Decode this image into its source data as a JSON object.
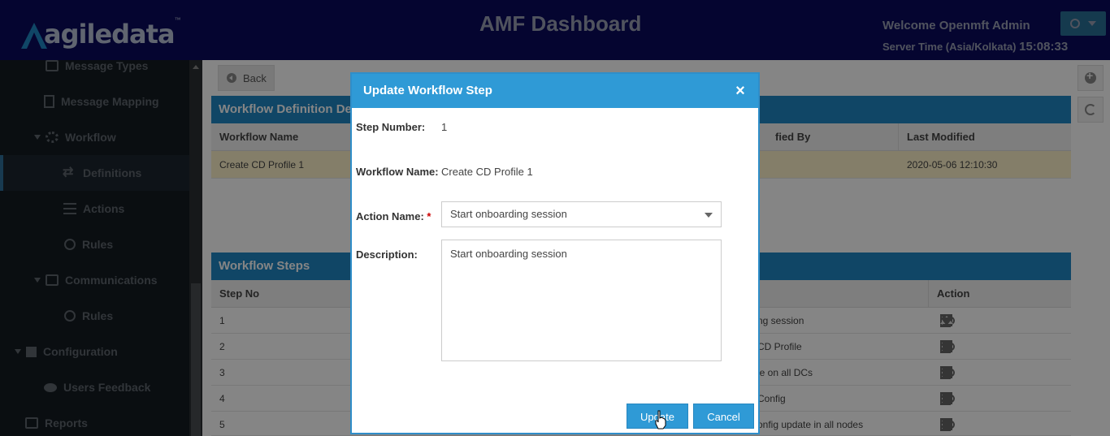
{
  "header": {
    "logo_text": "agiledata",
    "logo_tm": "™",
    "title": "AMF Dashboard",
    "welcome": "Welcome Openmft Admin",
    "server_time_label": "Server Time (Asia/Kolkata)",
    "server_time_value": "15:08:33"
  },
  "sidebar": {
    "items": [
      {
        "label": "Message Types",
        "icon": "box-icon"
      },
      {
        "label": "Message Mapping",
        "icon": "file-code-icon"
      },
      {
        "label": "Workflow",
        "icon": "gear-icon"
      },
      {
        "label": "Definitions",
        "icon": "swap-icon"
      },
      {
        "label": "Actions",
        "icon": "list-icon"
      },
      {
        "label": "Rules",
        "icon": "circle-down-icon"
      },
      {
        "label": "Communications",
        "icon": "share-icon"
      },
      {
        "label": "Rules",
        "icon": "circle-down-icon"
      },
      {
        "label": "Configuration",
        "icon": "puzzle-icon"
      },
      {
        "label": "Users Feedback",
        "icon": "comments-icon"
      },
      {
        "label": "Reports",
        "icon": "copy-icon"
      }
    ]
  },
  "main": {
    "back_label": "Back",
    "definition_panel_title": "Workflow Definition Deta",
    "definition_columns": [
      "Workflow Name",
      "fied By",
      "Last Modified"
    ],
    "definition_row": {
      "name": "Create CD Profile 1",
      "last_modified": "2020-05-06 12:10:30"
    },
    "steps_panel_title": "Workflow Steps",
    "steps_columns": [
      "Step No",
      "Action"
    ],
    "steps_rows": [
      {
        "no": "1",
        "desc": "ng session"
      },
      {
        "no": "2",
        "desc": "CD Profile"
      },
      {
        "no": "3",
        "desc": "le on all DCs"
      },
      {
        "no": "4",
        "desc": "Config"
      },
      {
        "no": "5",
        "desc": "onfig update in all nodes"
      }
    ]
  },
  "modal": {
    "title": "Update Workflow Step",
    "step_number_label": "Step Number:",
    "step_number_value": "1",
    "workflow_name_label": "Workflow Name:",
    "workflow_name_value": "Create CD Profile 1",
    "action_name_label": "Action Name:",
    "action_name_required": "*",
    "action_name_value": "Start onboarding session",
    "description_label": "Description:",
    "description_value": "Start onboarding session",
    "update_label": "Update",
    "cancel_label": "Cancel"
  }
}
